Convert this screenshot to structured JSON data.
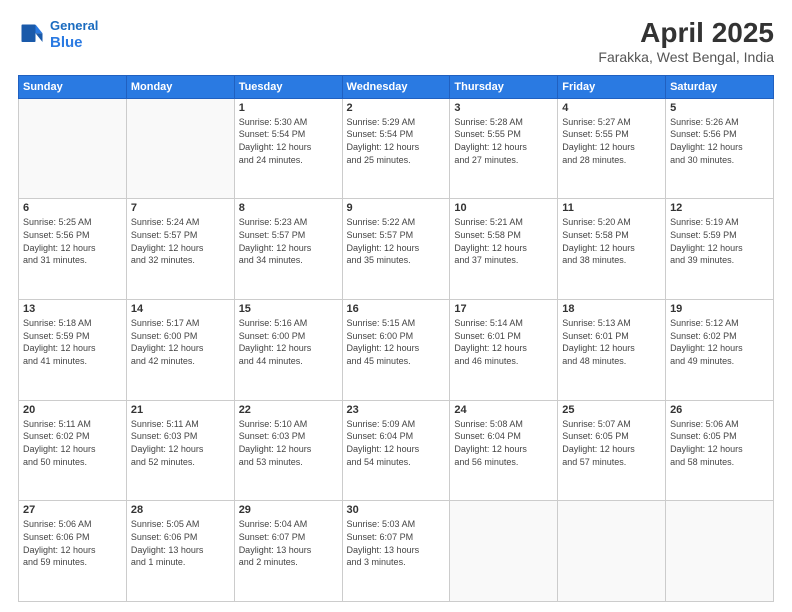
{
  "header": {
    "logo_line1": "General",
    "logo_line2": "Blue",
    "title": "April 2025",
    "subtitle": "Farakka, West Bengal, India"
  },
  "weekdays": [
    "Sunday",
    "Monday",
    "Tuesday",
    "Wednesday",
    "Thursday",
    "Friday",
    "Saturday"
  ],
  "weeks": [
    [
      {
        "day": "",
        "sunrise": "",
        "sunset": "",
        "daylight": ""
      },
      {
        "day": "",
        "sunrise": "",
        "sunset": "",
        "daylight": ""
      },
      {
        "day": "1",
        "sunrise": "Sunrise: 5:30 AM",
        "sunset": "Sunset: 5:54 PM",
        "daylight": "Daylight: 12 hours and 24 minutes."
      },
      {
        "day": "2",
        "sunrise": "Sunrise: 5:29 AM",
        "sunset": "Sunset: 5:54 PM",
        "daylight": "Daylight: 12 hours and 25 minutes."
      },
      {
        "day": "3",
        "sunrise": "Sunrise: 5:28 AM",
        "sunset": "Sunset: 5:55 PM",
        "daylight": "Daylight: 12 hours and 27 minutes."
      },
      {
        "day": "4",
        "sunrise": "Sunrise: 5:27 AM",
        "sunset": "Sunset: 5:55 PM",
        "daylight": "Daylight: 12 hours and 28 minutes."
      },
      {
        "day": "5",
        "sunrise": "Sunrise: 5:26 AM",
        "sunset": "Sunset: 5:56 PM",
        "daylight": "Daylight: 12 hours and 30 minutes."
      }
    ],
    [
      {
        "day": "6",
        "sunrise": "Sunrise: 5:25 AM",
        "sunset": "Sunset: 5:56 PM",
        "daylight": "Daylight: 12 hours and 31 minutes."
      },
      {
        "day": "7",
        "sunrise": "Sunrise: 5:24 AM",
        "sunset": "Sunset: 5:57 PM",
        "daylight": "Daylight: 12 hours and 32 minutes."
      },
      {
        "day": "8",
        "sunrise": "Sunrise: 5:23 AM",
        "sunset": "Sunset: 5:57 PM",
        "daylight": "Daylight: 12 hours and 34 minutes."
      },
      {
        "day": "9",
        "sunrise": "Sunrise: 5:22 AM",
        "sunset": "Sunset: 5:57 PM",
        "daylight": "Daylight: 12 hours and 35 minutes."
      },
      {
        "day": "10",
        "sunrise": "Sunrise: 5:21 AM",
        "sunset": "Sunset: 5:58 PM",
        "daylight": "Daylight: 12 hours and 37 minutes."
      },
      {
        "day": "11",
        "sunrise": "Sunrise: 5:20 AM",
        "sunset": "Sunset: 5:58 PM",
        "daylight": "Daylight: 12 hours and 38 minutes."
      },
      {
        "day": "12",
        "sunrise": "Sunrise: 5:19 AM",
        "sunset": "Sunset: 5:59 PM",
        "daylight": "Daylight: 12 hours and 39 minutes."
      }
    ],
    [
      {
        "day": "13",
        "sunrise": "Sunrise: 5:18 AM",
        "sunset": "Sunset: 5:59 PM",
        "daylight": "Daylight: 12 hours and 41 minutes."
      },
      {
        "day": "14",
        "sunrise": "Sunrise: 5:17 AM",
        "sunset": "Sunset: 6:00 PM",
        "daylight": "Daylight: 12 hours and 42 minutes."
      },
      {
        "day": "15",
        "sunrise": "Sunrise: 5:16 AM",
        "sunset": "Sunset: 6:00 PM",
        "daylight": "Daylight: 12 hours and 44 minutes."
      },
      {
        "day": "16",
        "sunrise": "Sunrise: 5:15 AM",
        "sunset": "Sunset: 6:00 PM",
        "daylight": "Daylight: 12 hours and 45 minutes."
      },
      {
        "day": "17",
        "sunrise": "Sunrise: 5:14 AM",
        "sunset": "Sunset: 6:01 PM",
        "daylight": "Daylight: 12 hours and 46 minutes."
      },
      {
        "day": "18",
        "sunrise": "Sunrise: 5:13 AM",
        "sunset": "Sunset: 6:01 PM",
        "daylight": "Daylight: 12 hours and 48 minutes."
      },
      {
        "day": "19",
        "sunrise": "Sunrise: 5:12 AM",
        "sunset": "Sunset: 6:02 PM",
        "daylight": "Daylight: 12 hours and 49 minutes."
      }
    ],
    [
      {
        "day": "20",
        "sunrise": "Sunrise: 5:11 AM",
        "sunset": "Sunset: 6:02 PM",
        "daylight": "Daylight: 12 hours and 50 minutes."
      },
      {
        "day": "21",
        "sunrise": "Sunrise: 5:11 AM",
        "sunset": "Sunset: 6:03 PM",
        "daylight": "Daylight: 12 hours and 52 minutes."
      },
      {
        "day": "22",
        "sunrise": "Sunrise: 5:10 AM",
        "sunset": "Sunset: 6:03 PM",
        "daylight": "Daylight: 12 hours and 53 minutes."
      },
      {
        "day": "23",
        "sunrise": "Sunrise: 5:09 AM",
        "sunset": "Sunset: 6:04 PM",
        "daylight": "Daylight: 12 hours and 54 minutes."
      },
      {
        "day": "24",
        "sunrise": "Sunrise: 5:08 AM",
        "sunset": "Sunset: 6:04 PM",
        "daylight": "Daylight: 12 hours and 56 minutes."
      },
      {
        "day": "25",
        "sunrise": "Sunrise: 5:07 AM",
        "sunset": "Sunset: 6:05 PM",
        "daylight": "Daylight: 12 hours and 57 minutes."
      },
      {
        "day": "26",
        "sunrise": "Sunrise: 5:06 AM",
        "sunset": "Sunset: 6:05 PM",
        "daylight": "Daylight: 12 hours and 58 minutes."
      }
    ],
    [
      {
        "day": "27",
        "sunrise": "Sunrise: 5:06 AM",
        "sunset": "Sunset: 6:06 PM",
        "daylight": "Daylight: 12 hours and 59 minutes."
      },
      {
        "day": "28",
        "sunrise": "Sunrise: 5:05 AM",
        "sunset": "Sunset: 6:06 PM",
        "daylight": "Daylight: 13 hours and 1 minute."
      },
      {
        "day": "29",
        "sunrise": "Sunrise: 5:04 AM",
        "sunset": "Sunset: 6:07 PM",
        "daylight": "Daylight: 13 hours and 2 minutes."
      },
      {
        "day": "30",
        "sunrise": "Sunrise: 5:03 AM",
        "sunset": "Sunset: 6:07 PM",
        "daylight": "Daylight: 13 hours and 3 minutes."
      },
      {
        "day": "",
        "sunrise": "",
        "sunset": "",
        "daylight": ""
      },
      {
        "day": "",
        "sunrise": "",
        "sunset": "",
        "daylight": ""
      },
      {
        "day": "",
        "sunrise": "",
        "sunset": "",
        "daylight": ""
      }
    ]
  ]
}
